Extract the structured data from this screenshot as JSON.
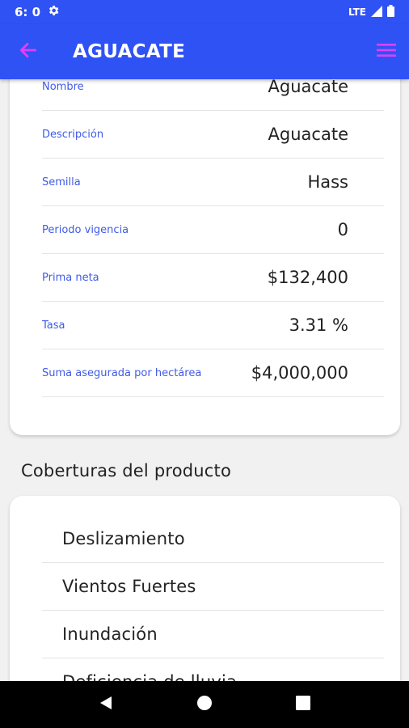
{
  "status_bar": {
    "time": "6: 0",
    "network": "LTE",
    "icons": [
      "gear-icon",
      "signal-icon",
      "battery-icon"
    ]
  },
  "app_bar": {
    "title": "AGUACATE",
    "back_icon": "arrow-left-icon",
    "menu_icon": "menu-icon",
    "accent_color": "#e040fb",
    "bar_color": "#2f52f5"
  },
  "details": [
    {
      "label": "Nombre",
      "value": "Aguacate"
    },
    {
      "label": "Descripción",
      "value": "Aguacate"
    },
    {
      "label": "Semilla",
      "value": "Hass"
    },
    {
      "label": "Periodo vigencia",
      "value": "0"
    },
    {
      "label": "Prima neta",
      "value": "$132,400"
    },
    {
      "label": "Tasa",
      "value": "3.31 %"
    },
    {
      "label": "Suma asegurada por hectárea",
      "value": "$4,000,000"
    }
  ],
  "coverage": {
    "title": "Coberturas del producto",
    "items": [
      "Deslizamiento",
      "Vientos Fuertes",
      "Inundación",
      "Deficiencia de lluvia"
    ]
  },
  "nav_bar": {
    "icons": [
      "back-triangle-icon",
      "home-circle-icon",
      "recents-square-icon"
    ]
  }
}
